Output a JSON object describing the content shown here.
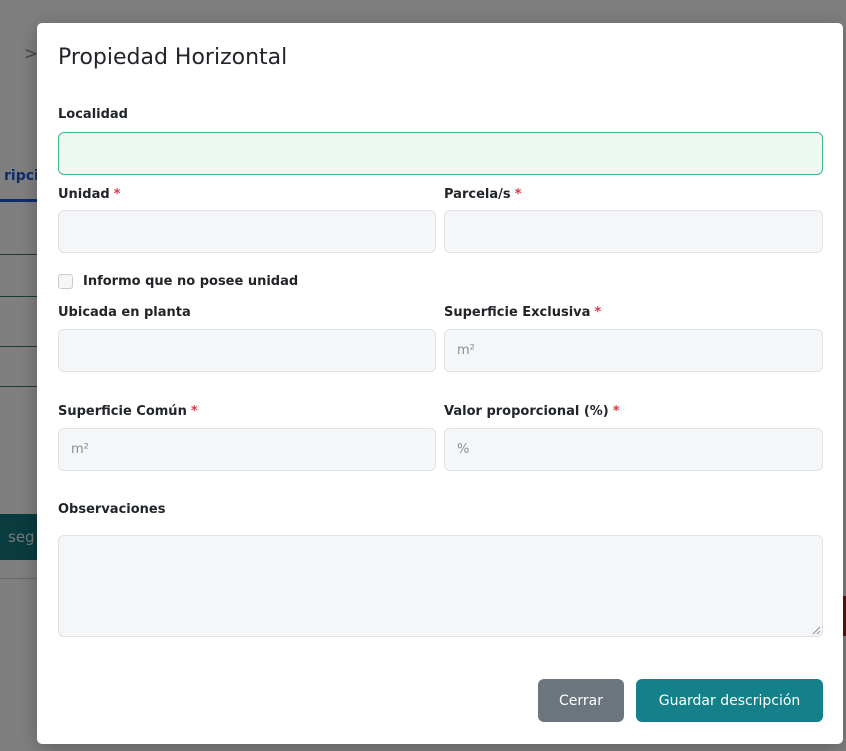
{
  "background": {
    "breadcrumb_chevron": ">",
    "tab_partial": "ripci",
    "button_partial": "seg"
  },
  "modal": {
    "title": "Propiedad Horizontal",
    "fields": {
      "localidad": {
        "label": "Localidad",
        "value": "",
        "placeholder": ""
      },
      "unidad": {
        "label": "Unidad",
        "required_mark": "*",
        "value": "",
        "placeholder": ""
      },
      "parcelas": {
        "label": "Parcela/s",
        "required_mark": "*",
        "value": "",
        "placeholder": ""
      },
      "no_unidad": {
        "label": "Informo que no posee unidad",
        "checked": false
      },
      "ubicada_planta": {
        "label": "Ubicada en planta",
        "value": "",
        "placeholder": ""
      },
      "superficie_exclusiva": {
        "label": "Superficie Exclusiva",
        "required_mark": "*",
        "value": "",
        "placeholder": "m²"
      },
      "superficie_comun": {
        "label": "Superficie Común",
        "required_mark": "*",
        "value": "",
        "placeholder": "m²"
      },
      "valor_proporcional": {
        "label": "Valor proporcional (%)",
        "required_mark": "*",
        "value": "",
        "placeholder": "%"
      },
      "observaciones": {
        "label": "Observaciones",
        "value": ""
      }
    },
    "buttons": {
      "close_label": "Cerrar",
      "save_label": "Guardar descripción"
    }
  },
  "colors": {
    "primary_teal": "#14808a",
    "secondary_gray": "#6c757d",
    "required_red": "#dc3545",
    "focus_green": "#43b583"
  }
}
